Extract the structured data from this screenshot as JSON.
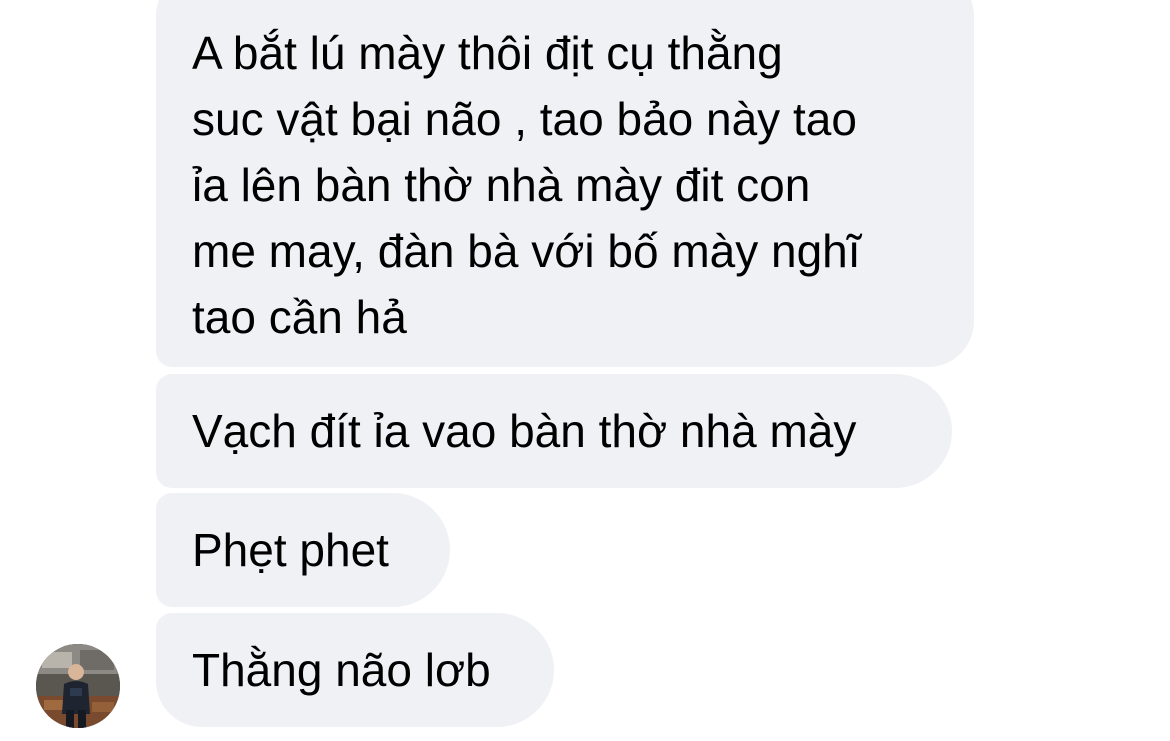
{
  "conversation": {
    "messages": [
      {
        "lines": [
          "A bắt lú mày thôi địt cụ thằng",
          "suc vật bại não , tao bảo này tao",
          "ỉa lên bàn thờ nhà mày đit con",
          "me may, đàn bà với bố mày nghĩ",
          "tao cần hả"
        ]
      },
      {
        "text": "Vạch đít ỉa vao bàn thờ nhà mày"
      },
      {
        "text": "Phẹt phet"
      },
      {
        "text": "Thằng não lơb"
      }
    ]
  },
  "sender": {
    "avatar_icon": "user-photo-avatar"
  },
  "colors": {
    "bubble_background": "#f0f1f5",
    "text": "#000000",
    "page_background": "#ffffff"
  }
}
